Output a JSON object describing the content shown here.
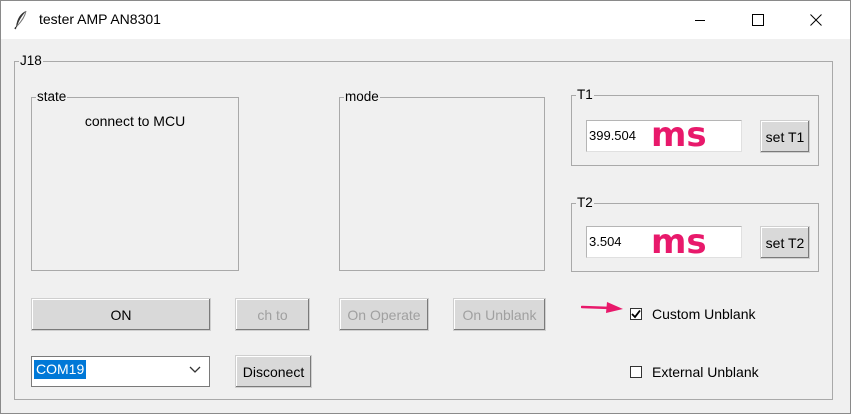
{
  "window": {
    "title": "tester AMP AN8301",
    "controls": [
      "minimize",
      "maximize",
      "close"
    ]
  },
  "main_group": {
    "label": "J18"
  },
  "state_group": {
    "label": "state",
    "status_text": "connect to MCU"
  },
  "mode_group": {
    "label": "mode"
  },
  "t1": {
    "label": "T1",
    "value": "399.504",
    "unit": "ms",
    "button_label": "set T1"
  },
  "t2": {
    "label": "T2",
    "value": "3.504",
    "unit": "ms",
    "button_label": "set T2"
  },
  "buttons": {
    "on": "ON",
    "ch_to": "ch to",
    "on_operate": "On Operate",
    "on_unblank": "On Unblank",
    "disconnect": "Disconect"
  },
  "port_select": {
    "value": "COM19"
  },
  "checkboxes": {
    "custom_unblank": {
      "label": "Custom Unblank",
      "checked": true
    },
    "external_unblank": {
      "label": "External Unblank",
      "checked": false
    }
  },
  "colors": {
    "annotation": "#e8196b",
    "selection": "#0078d7",
    "window_bg": "#f0f0f0"
  }
}
